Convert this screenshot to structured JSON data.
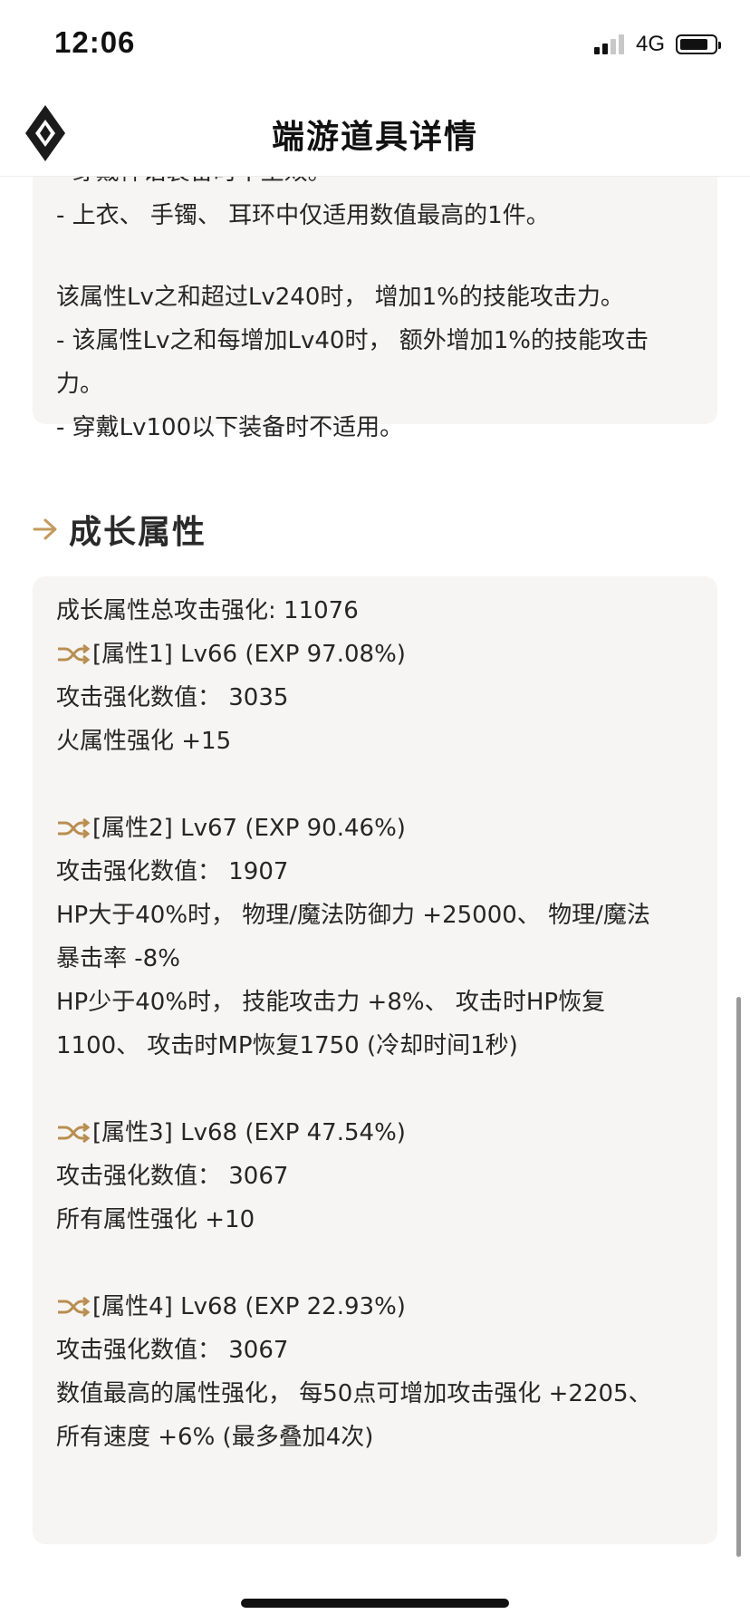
{
  "status_bar": {
    "time": "12:06",
    "network": "4G"
  },
  "header": {
    "title": "端游道具详情"
  },
  "top_card": {
    "lines": [
      "- 穿戴神话装备时不生效。",
      "- 上衣、 手镯、 耳环中仅适用数值最高的1件。",
      "",
      "该属性Lv之和超过Lv240时， 增加1%的技能攻击力。",
      "- 该属性Lv之和每增加Lv40时， 额外增加1%的技能攻击",
      "力。",
      "- 穿戴Lv100以下装备时不适用。"
    ]
  },
  "growth_section": {
    "title": "成长属性",
    "total": "成长属性总攻击强化: 11076",
    "attributes": [
      {
        "header": "[属性1] Lv66 (EXP 97.08%)",
        "lines": [
          "攻击强化数值： 3035",
          "火属性强化 +15"
        ]
      },
      {
        "header": "[属性2] Lv67 (EXP 90.46%)",
        "lines": [
          "攻击强化数值： 1907",
          "HP大于40%时， 物理/魔法防御力 +25000、 物理/魔法",
          "暴击率 -8%",
          "HP少于40%时， 技能攻击力 +8%、 攻击时HP恢复",
          "1100、 攻击时MP恢复1750 (冷却时间1秒)"
        ]
      },
      {
        "header": "[属性3] Lv68 (EXP 47.54%)",
        "lines": [
          "攻击强化数值： 3067",
          "所有属性强化 +10"
        ]
      },
      {
        "header": "[属性4] Lv68 (EXP 22.93%)",
        "lines": [
          "攻击强化数值： 3067",
          "数值最高的属性强化， 每50点可增加攻击强化 +2205、",
          "所有速度 +6% (最多叠加4次)"
        ]
      }
    ]
  },
  "colors": {
    "accent": "#c29a5c",
    "card_bg": "#f6f5f3",
    "text": "#262626"
  },
  "icons": [
    "app-logo-icon",
    "arrow-right-icon",
    "shuffle-icon",
    "battery-icon",
    "signal-icon"
  ]
}
